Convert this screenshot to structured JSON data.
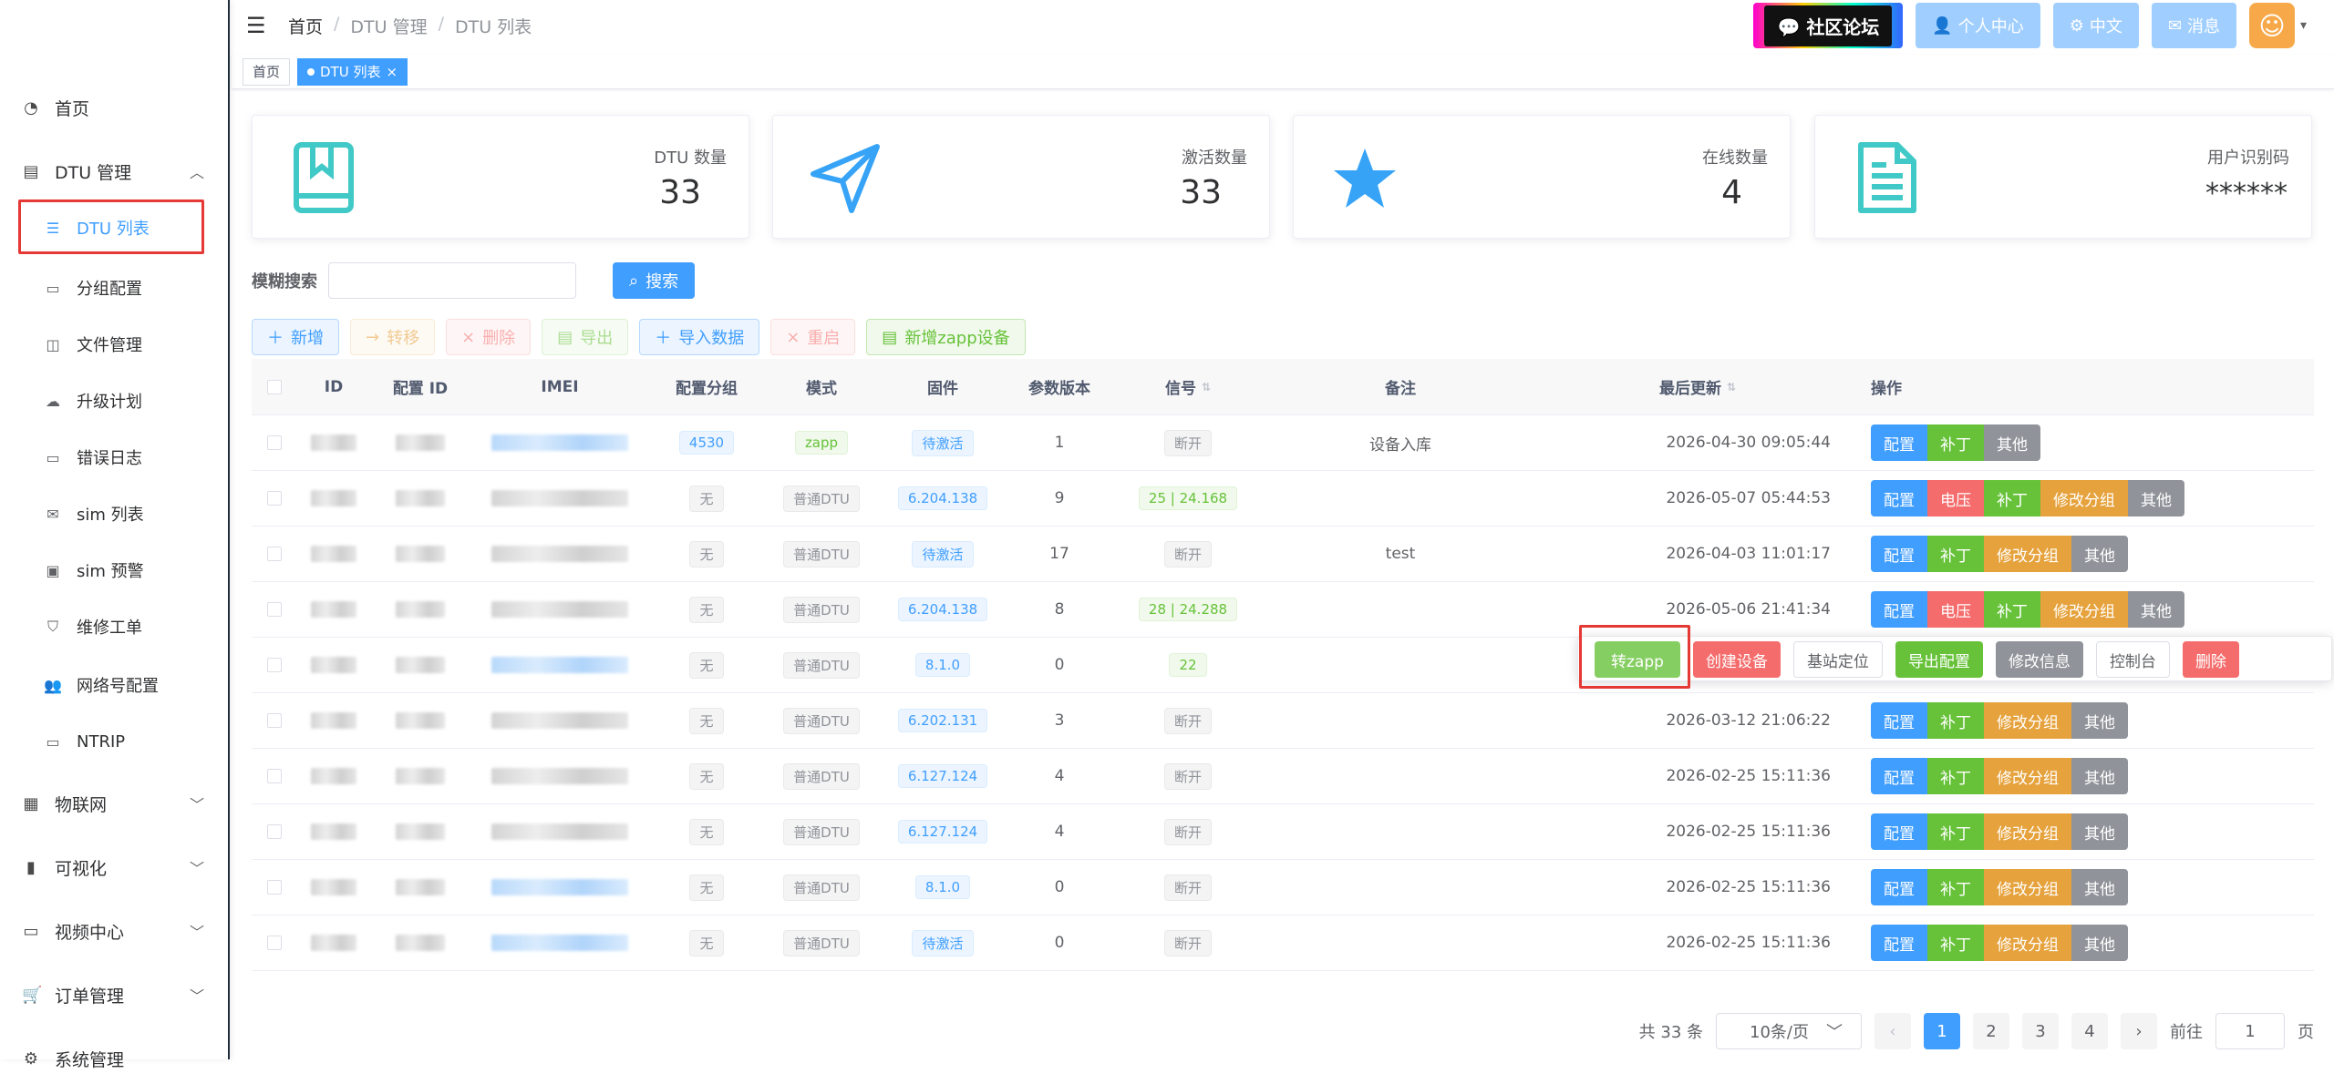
{
  "header": {
    "breadcrumb": [
      "首页",
      "DTU 管理",
      "DTU 列表"
    ],
    "forum": "社区论坛",
    "personal": "个人中心",
    "lang": "中文",
    "messages": "消息"
  },
  "sidebar": {
    "items": [
      {
        "label": "首页"
      },
      {
        "label": "DTU 管理"
      },
      {
        "label": "物联网"
      },
      {
        "label": "可视化"
      },
      {
        "label": "视频中心"
      },
      {
        "label": "订单管理"
      },
      {
        "label": "系统管理"
      }
    ],
    "sub": [
      {
        "label": "DTU 列表"
      },
      {
        "label": "分组配置"
      },
      {
        "label": "文件管理"
      },
      {
        "label": "升级计划"
      },
      {
        "label": "错误日志"
      },
      {
        "label": "sim 列表"
      },
      {
        "label": "sim 预警"
      },
      {
        "label": "维修工单"
      },
      {
        "label": "网络号配置"
      },
      {
        "label": "NTRIP"
      }
    ]
  },
  "tabs": [
    "首页",
    "DTU 列表"
  ],
  "cards": [
    {
      "label": "DTU 数量",
      "value": "33",
      "icon": "book-icon",
      "color": "#40c9c6"
    },
    {
      "label": "激活数量",
      "value": "33",
      "icon": "send-icon",
      "color": "#36a3f7"
    },
    {
      "label": "在线数量",
      "value": "4",
      "icon": "star-icon",
      "color": "#36a3f7"
    },
    {
      "label": "用户识别码",
      "value": "******",
      "icon": "document-icon",
      "color": "#40c9c6"
    }
  ],
  "search": {
    "label": "模糊搜索",
    "placeholder": "",
    "button": "搜索"
  },
  "toolbar": {
    "add": "新增",
    "transfer": "转移",
    "delete": "删除",
    "export": "导出",
    "import": "导入数据",
    "restart": "重启",
    "add_zapp": "新增zapp设备"
  },
  "table": {
    "columns": [
      "ID",
      "配置 ID",
      "IMEI",
      "配置分组",
      "模式",
      "固件",
      "参数版本",
      "信号",
      "备注",
      "最后更新",
      "操作"
    ],
    "rows": [
      {
        "group": "4530",
        "mode": "zapp",
        "firmware": "待激活",
        "param": "1",
        "signal": "断开",
        "note": "设备入库",
        "updated": "2026-04-30 09:05:44"
      },
      {
        "group": "无",
        "mode": "普通DTU",
        "firmware": "6.204.138",
        "param": "9",
        "signal": "25 | 24.168",
        "note": "",
        "updated": "2026-05-07 05:44:53"
      },
      {
        "group": "无",
        "mode": "普通DTU",
        "firmware": "待激活",
        "param": "17",
        "signal": "断开",
        "note": "test",
        "updated": "2026-04-03 11:01:17"
      },
      {
        "group": "无",
        "mode": "普通DTU",
        "firmware": "6.204.138",
        "param": "8",
        "signal": "28 | 24.288",
        "note": "",
        "updated": "2026-05-06 21:41:34"
      },
      {
        "group": "无",
        "mode": "普通DTU",
        "firmware": "8.1.0",
        "param": "0",
        "signal": "22",
        "note": "",
        "updated": ""
      },
      {
        "group": "无",
        "mode": "普通DTU",
        "firmware": "6.202.131",
        "param": "3",
        "signal": "断开",
        "note": "",
        "updated": "2026-03-12 21:06:22"
      },
      {
        "group": "无",
        "mode": "普通DTU",
        "firmware": "6.127.124",
        "param": "4",
        "signal": "断开",
        "note": "",
        "updated": "2026-02-25 15:11:36"
      },
      {
        "group": "无",
        "mode": "普通DTU",
        "firmware": "6.127.124",
        "param": "4",
        "signal": "断开",
        "note": "",
        "updated": "2026-02-25 15:11:36"
      },
      {
        "group": "无",
        "mode": "普通DTU",
        "firmware": "8.1.0",
        "param": "0",
        "signal": "断开",
        "note": "",
        "updated": "2026-02-25 15:11:36"
      },
      {
        "group": "无",
        "mode": "普通DTU",
        "firmware": "待激活",
        "param": "0",
        "signal": "断开",
        "note": "",
        "updated": "2026-02-25 15:11:36"
      }
    ]
  },
  "ops": {
    "config": "配置",
    "voltage": "电压",
    "patch": "补丁",
    "edit_group": "修改分组",
    "other": "其他",
    "to_zapp": "转zapp",
    "create_device": "创建设备",
    "locate": "基站定位",
    "export_config": "导出配置",
    "edit_info": "修改信息",
    "console": "控制台",
    "remove": "删除"
  },
  "pager": {
    "total": "共 33 条",
    "size": "10条/页",
    "pages": [
      "1",
      "2",
      "3",
      "4"
    ],
    "goto": "前往",
    "page_value": "1",
    "suffix": "页"
  }
}
